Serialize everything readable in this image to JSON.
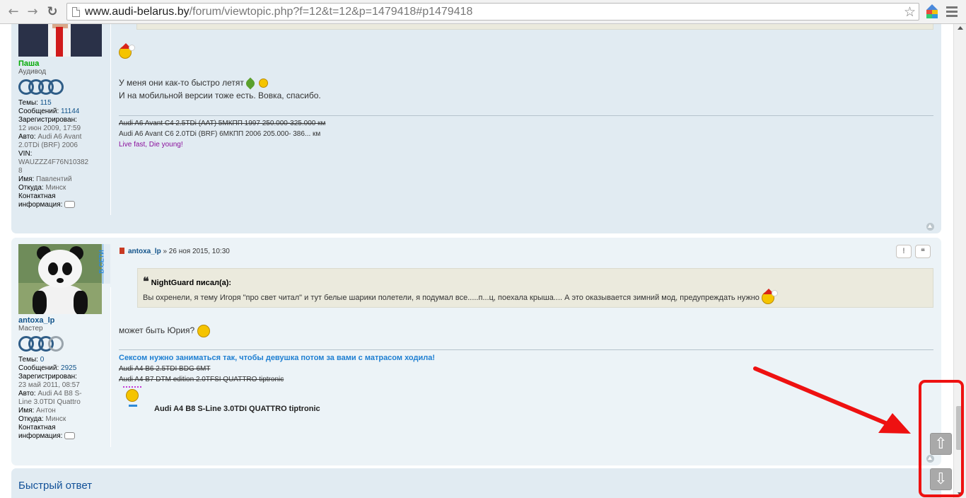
{
  "browser": {
    "url_host": "www.audi-belarus.by",
    "url_path": "/forum/viewtopic.php?f=12&t=12&p=1479418#p1479418",
    "back_glyph": "←",
    "forward_glyph": "→",
    "reload_glyph": "↻",
    "star_glyph": "☆"
  },
  "post1": {
    "username": "Паша",
    "rank": "Аудивод",
    "profile": {
      "topics_label": "Темы:",
      "topics_value": "115",
      "messages_label": "Сообщений:",
      "messages_value": "11144",
      "registered_label": "Зарегистрирован:",
      "registered_value": "12 июн 2009, 17:59",
      "car_label": "Авто:",
      "car_value_1": "Audi A6 Avant",
      "car_value_2": "2.0TDi (BRF) 2006",
      "vin_label": "VIN:",
      "vin_value_1": "WAUZZZ4F76N10382",
      "vin_value_2": "8",
      "name_label": "Имя:",
      "name_value": "Павлентий",
      "from_label": "Откуда:",
      "from_value": "Минск",
      "contact_label_1": "Контактная",
      "contact_label_2": "информация:"
    },
    "text_line_1": "У меня они как-то быстро летят",
    "text_line_2": "И на мобильной версии тоже есть. Вовка, спасибо.",
    "sig_line_1": "Audi A6 Avant C4 2.5TDi (AAT) 5МКПП 1997 250.000-325.000 км",
    "sig_line_2": "Audi A6 Avant C6 2.0TDi (BRF) 6МКПП 2006 205.000- 386... км",
    "sig_line_3": "Live fast, Die young!"
  },
  "post2": {
    "username": "antoxa_lp",
    "rank": "Мастер",
    "online_label": "В СЕТИ",
    "header_author": "antoxa_lp",
    "header_date": " » 26 ноя 2015, 10:30",
    "report_label": "!",
    "quote_label": "❝",
    "profile": {
      "topics_label": "Темы:",
      "topics_value": "0",
      "messages_label": "Сообщений:",
      "messages_value": "2925",
      "registered_label": "Зарегистрирован:",
      "registered_value": "23 май 2011, 08:57",
      "car_label": "Авто:",
      "car_value_1": "Audi A4 B8 S-",
      "car_value_2": "Line 3.0TDI Quattro",
      "name_label": "Имя:",
      "name_value": "Антон",
      "from_label": "Откуда:",
      "from_value": "Минск",
      "contact_label_1": "Контактная",
      "contact_label_2": "информация:"
    },
    "quote_author": "NightGuard писал(а):",
    "quote_text": "Вы охренели, я тему Игоря \"про свет читал\" и тут белые шарики полетели, я подумал все.....п...ц, поехала крыша.... А это оказывается зимний мод, предупреждать нужно",
    "text": "может быть Юрия?",
    "sig_blue": "Сексом нужно заниматься так, чтобы девушка потом за вами с матрасом ходила!",
    "sig_strike_1": "Audi A4 B6 2.5TDI BDG 6MT",
    "sig_strike_2": "Audi A4 B7 DTM edition 2.0TFSI QUATTRO tiptronic",
    "sig_bold": "Audi A4 B8 S-Line 3.0TDI QUATTRO tiptronic"
  },
  "quick_reply": "Быстрый ответ",
  "float_buttons": {
    "up": "⇧",
    "down": "⇩"
  },
  "colors": {
    "annotation_red": "#ee1111",
    "link_blue": "#105289",
    "post_bg": "#e1ebf2"
  }
}
